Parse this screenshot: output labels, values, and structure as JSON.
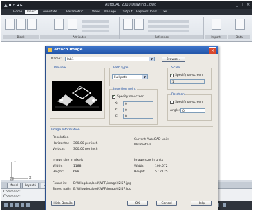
{
  "app": {
    "title": "AutoCAD 2010  Drawing1.dwg",
    "tabs": [
      "Home",
      "Insert",
      "Annotate",
      "Parametric",
      "View",
      "Manage",
      "Output",
      "Express Tools",
      "xx"
    ],
    "active_tab": 1,
    "ribbon_panels": [
      "Block",
      "Attributes",
      "Reference",
      "Import",
      "Data"
    ],
    "model_tabs": [
      "Model",
      "Layout1",
      "Layout2"
    ],
    "command_lines": [
      "Command:",
      "Command:"
    ],
    "ucs": {
      "x": "X",
      "y": "Y"
    }
  },
  "dialog": {
    "title": "Attach Image",
    "name_label": "Name:",
    "name_value": "lab1",
    "browse_label": "Browse...",
    "preview_label": "Preview",
    "path_type": {
      "label": "Path type",
      "value": "Full path"
    },
    "insertion": {
      "label": "Insertion point",
      "specify_on_screen": "Specify on-screen",
      "x": "X:",
      "y": "Y:",
      "z": "Z:",
      "x_value": "0",
      "y_value": "0",
      "z_value": "0"
    },
    "scale": {
      "label": "Scale",
      "specify_on_screen": "Specify on-screen",
      "value": "1"
    },
    "rotation": {
      "label": "Rotation",
      "specify_on_screen": "Specify on-screen",
      "angle_label": "Angle:",
      "angle_value": "0"
    },
    "image_info": {
      "label": "Image Information",
      "resolution": "Resolution",
      "horizontal_label": "Horizontal:",
      "horizontal_value": "300.00 per inch",
      "vertical_label": "Vertical:",
      "vertical_value": "300.00 per inch",
      "current_unit_label": "Current AutoCAD unit:",
      "current_unit_value": "Millimeters",
      "size_pixels_label": "Image size in pixels",
      "width_label": "Width:",
      "width_pixels": "1188",
      "height_label": "Height:",
      "height_pixels": "688",
      "size_units_label": "Image size in units",
      "width_units": "100.572",
      "height_units": "57.7125",
      "found_in_label": "Found in:",
      "found_in_value": "E:\\Wlogdoc\\lsed\\WPF\\image\\l2l57.jpg",
      "saved_path_label": "Saved path:",
      "saved_path_value": "E:\\Wlogdoc\\lsed\\WPF\\image\\l2l57.jpg"
    },
    "hide_details": "Hide Details",
    "ok": "OK",
    "cancel": "Cancel",
    "help": "Help"
  },
  "colors": {
    "dialog_title": "#2356aa",
    "close": "#d9482e",
    "titlebar": "#1e2228"
  }
}
